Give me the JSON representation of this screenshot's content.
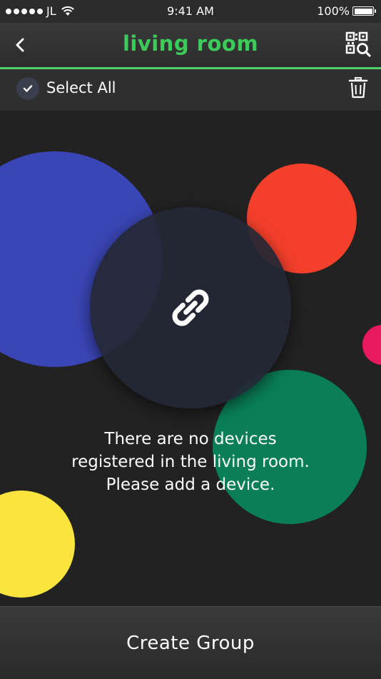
{
  "status": {
    "carrier": "JL",
    "time": "9:41 AM",
    "battery": "100%"
  },
  "nav": {
    "title": "living room",
    "back_icon": "chevron-left-icon",
    "qr_icon": "qr-search-icon"
  },
  "select": {
    "label": "Select All",
    "trash_icon": "trash-icon"
  },
  "content": {
    "center_icon": "link-icon",
    "message": "There are no devices\nregistered in the living room.\nPlease add a device."
  },
  "footer": {
    "create_group_label": "Create Group"
  },
  "colors": {
    "accent": "#3ccb5a",
    "blue": "#3a46b5",
    "red": "#f4402b",
    "green": "#0a7f57",
    "yellow": "#fae43e",
    "pink": "#e8195f"
  }
}
